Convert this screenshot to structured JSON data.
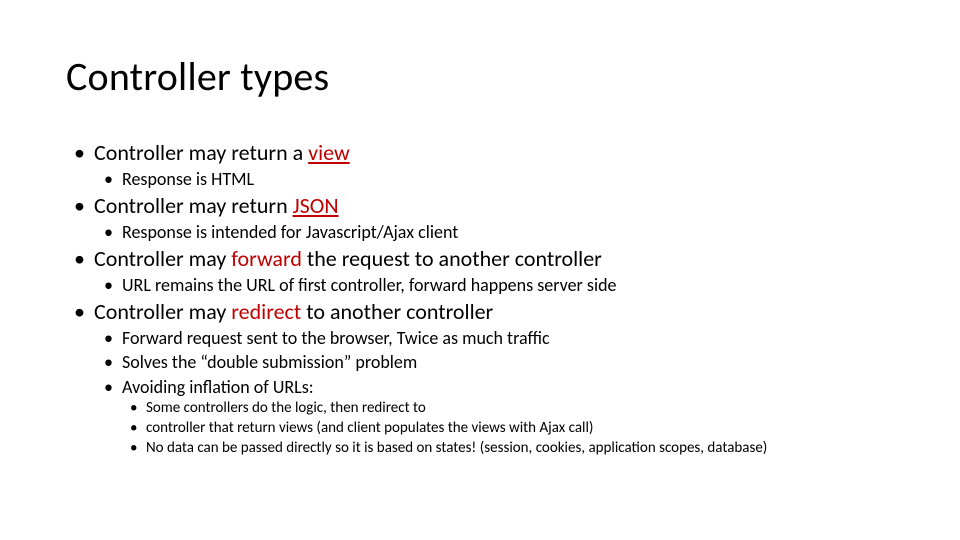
{
  "title": "Controller types",
  "accent_color": "#c00000",
  "b1": {
    "prefix": "Controller may return a ",
    "accent": "view",
    "accent_underline": true
  },
  "b1s": {
    "a": "Response is HTML"
  },
  "b2": {
    "prefix": "Controller may return ",
    "accent": "JSON",
    "accent_underline": true
  },
  "b2s": {
    "a": "Response is intended for Javascript/Ajax client"
  },
  "b3": {
    "prefix": "Controller may ",
    "accent": "forward",
    "suffix": " the request to another controller"
  },
  "b3s": {
    "a": "URL remains the URL of first controller, forward happens server side"
  },
  "b4": {
    "prefix": "Controller may ",
    "accent": "redirect",
    "suffix": " to another controller"
  },
  "b4s": {
    "a": "Forward request sent to the browser, Twice as much traffic",
    "b": "Solves the “double submission” problem",
    "c": "Avoiding inflation of URLs:"
  },
  "b4s_c_sub": {
    "a": "Some controllers do the logic, then redirect to",
    "b": "controller that return views (and client populates the views with Ajax call)",
    "c": "No data can be passed directly so it is based on states! (session, cookies, application scopes, database)"
  }
}
